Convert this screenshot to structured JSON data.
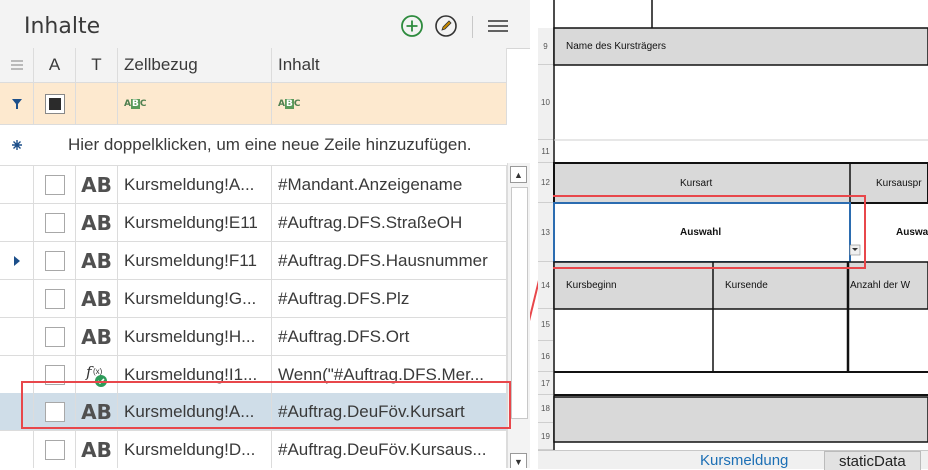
{
  "panel": {
    "title": "Inhalte",
    "add_icon": "plus-circle-icon",
    "edit_icon": "pencil-circle-icon",
    "menu_icon": "hamburger-menu-icon"
  },
  "grid": {
    "headers": [
      "A",
      "T",
      "Zellbezug",
      "Inhalt"
    ],
    "new_row_hint": "Hier doppelklicken, um eine neue Zeile hinzuzufügen.",
    "rows": [
      {
        "type": "AB",
        "ref": "Kursmeldung!A...",
        "content": "#Mandant.Anzeigename",
        "selected": false
      },
      {
        "type": "AB",
        "ref": "Kursmeldung!E11",
        "content": "#Auftrag.DFS.StraßeOH",
        "selected": false
      },
      {
        "type": "AB",
        "ref": "Kursmeldung!F11",
        "content": "#Auftrag.DFS.Hausnummer",
        "selected": false
      },
      {
        "type": "AB",
        "ref": "Kursmeldung!G...",
        "content": "#Auftrag.DFS.Plz",
        "selected": false
      },
      {
        "type": "AB",
        "ref": "Kursmeldung!H...",
        "content": "#Auftrag.DFS.Ort",
        "selected": false
      },
      {
        "type": "f",
        "ref": "Kursmeldung!I1...",
        "content": "Wenn(\"#Auftrag.DFS.Mer...",
        "selected": false
      },
      {
        "type": "AB",
        "ref": "Kursmeldung!A...",
        "content": "#Auftrag.DeuFöv.Kursart",
        "selected": true
      },
      {
        "type": "AB",
        "ref": "Kursmeldung!D...",
        "content": "#Auftrag.DeuFöv.Kursaus...",
        "selected": false
      }
    ]
  },
  "sheet": {
    "row_numbers": [
      "9",
      "10",
      "11",
      "12",
      "13",
      "14",
      "15",
      "16",
      "17",
      "18",
      "19"
    ],
    "name_kurstraeger": "Name des Kursträgers",
    "kursart": "Kursart",
    "kursauspr": "Kursauspr",
    "auswahl": "Auswahl",
    "auswa": "Auswa",
    "kursbeginn": "Kursbeginn",
    "kursende": "Kursende",
    "anzahl": "Anzahl der W",
    "tabs": [
      "Kursmeldung",
      "staticData"
    ]
  },
  "colors": {
    "accent_red": "#e8474b",
    "filter_row": "#fde9cf",
    "selected_row": "#cfdde8",
    "add_green": "#2e8b3e",
    "edit_amber": "#c68a00"
  }
}
